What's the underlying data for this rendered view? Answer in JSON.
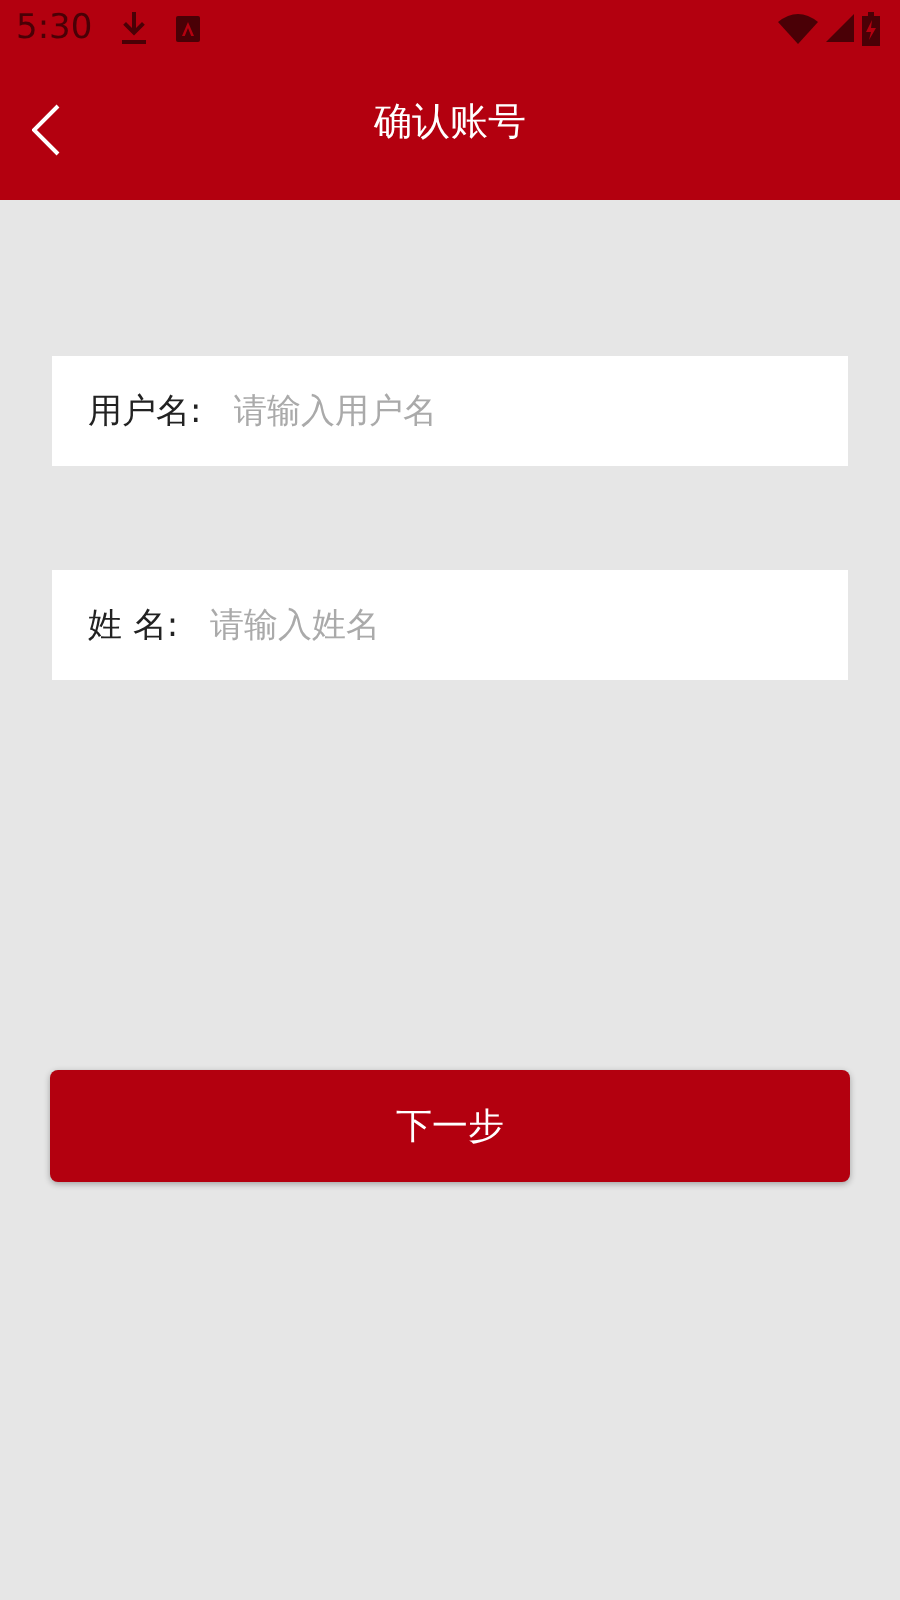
{
  "status_bar": {
    "time": "5:30"
  },
  "header": {
    "title": "确认账号"
  },
  "fields": [
    {
      "label": "用户名:",
      "placeholder": "请输入用户名"
    },
    {
      "label": "姓 名:",
      "placeholder": "请输入姓名"
    }
  ],
  "next_button": {
    "label": "下一步"
  }
}
